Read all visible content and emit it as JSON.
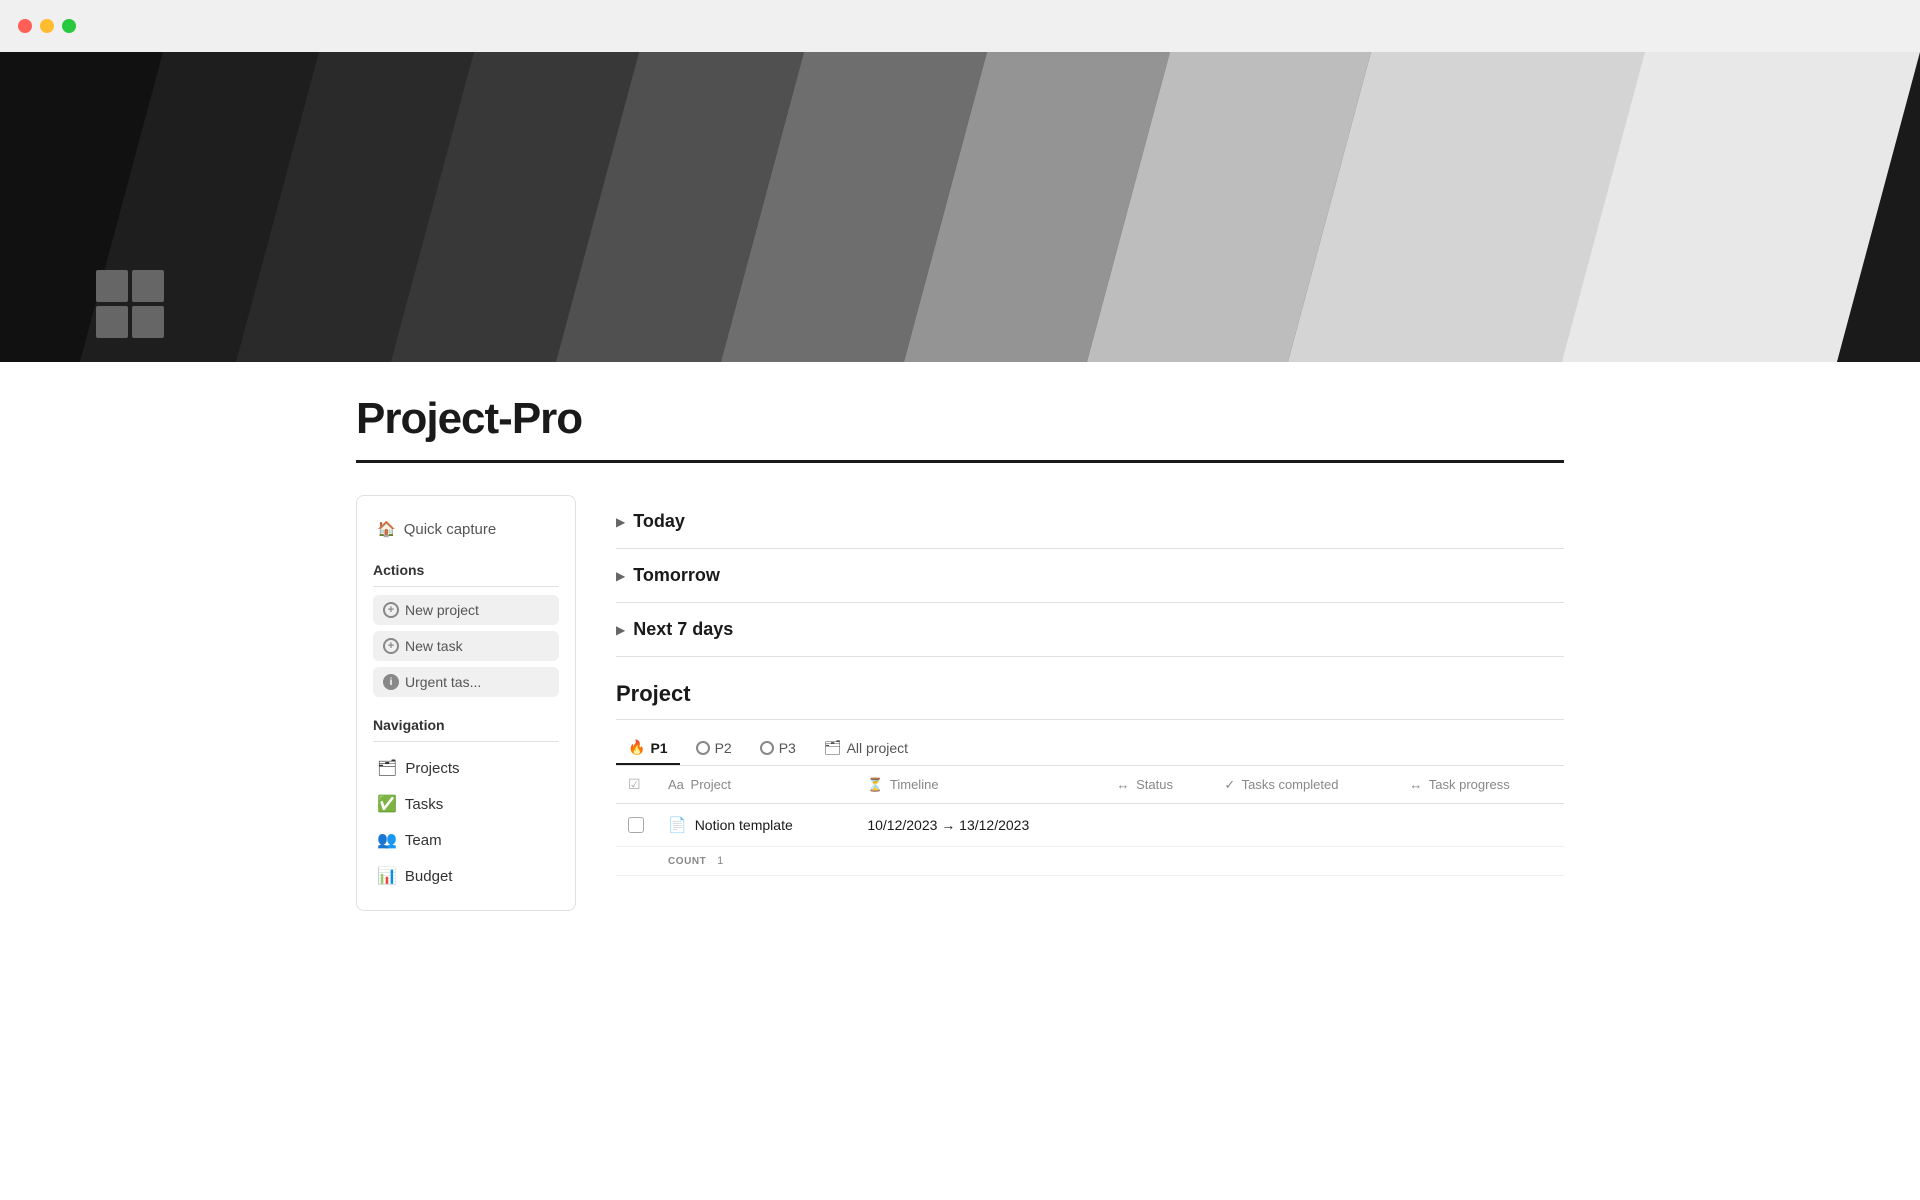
{
  "titlebar": {
    "buttons": [
      "close",
      "minimize",
      "maximize"
    ]
  },
  "hero": {
    "stripes": [
      {
        "color": "#111111",
        "width": "18%"
      },
      {
        "color": "#1e1e1e",
        "width": "14%"
      },
      {
        "color": "#2a2a2a",
        "width": "14%"
      },
      {
        "color": "#383838",
        "width": "14%"
      },
      {
        "color": "#505050",
        "width": "14%"
      },
      {
        "color": "#6e6e6e",
        "width": "13%"
      },
      {
        "color": "#949494",
        "width": "13%"
      },
      {
        "color": "#c0c0c0",
        "width": "13%"
      },
      {
        "color": "#d8d8d8",
        "width": "12%"
      }
    ]
  },
  "page": {
    "title": "Project-Pro",
    "icon_alt": "Project-Pro icon"
  },
  "sidebar": {
    "quick_capture_label": "Quick capture",
    "actions_section": "Actions",
    "action_buttons": [
      {
        "label": "New project",
        "icon": "plus"
      },
      {
        "label": "New task",
        "icon": "plus"
      },
      {
        "label": "Urgent tas...",
        "icon": "info"
      }
    ],
    "navigation_section": "Navigation",
    "nav_items": [
      {
        "label": "Projects",
        "icon": "🗂"
      },
      {
        "label": "Tasks",
        "icon": "✅"
      },
      {
        "label": "Team",
        "icon": "👥"
      },
      {
        "label": "Budget",
        "icon": "📊"
      }
    ]
  },
  "main": {
    "sections": [
      {
        "label": "Today",
        "collapsed": true
      },
      {
        "label": "Tomorrow",
        "collapsed": true
      },
      {
        "label": "Next 7 days",
        "collapsed": true
      }
    ],
    "project_heading": "Project",
    "tabs": [
      {
        "label": "P1",
        "icon": "🔥",
        "active": true
      },
      {
        "label": "P2",
        "icon": "circle",
        "active": false
      },
      {
        "label": "P3",
        "icon": "circle",
        "active": false
      },
      {
        "label": "All project",
        "icon": "folder",
        "active": false
      }
    ],
    "table": {
      "headers": [
        {
          "label": "",
          "icon": "☑"
        },
        {
          "label": "Project",
          "icon": "Aa"
        },
        {
          "label": "Timeline",
          "icon": "⏳"
        },
        {
          "label": "Status",
          "icon": "↔"
        },
        {
          "label": "Tasks completed",
          "icon": "✓"
        },
        {
          "label": "Task progress",
          "icon": "↔"
        }
      ],
      "rows": [
        {
          "name": "Notion template",
          "icon": "📄",
          "timeline": "10/12/2023 → 13/12/2023",
          "status": "",
          "tasks_completed": "",
          "task_progress": ""
        }
      ],
      "count_label": "COUNT",
      "count_value": "1"
    }
  }
}
